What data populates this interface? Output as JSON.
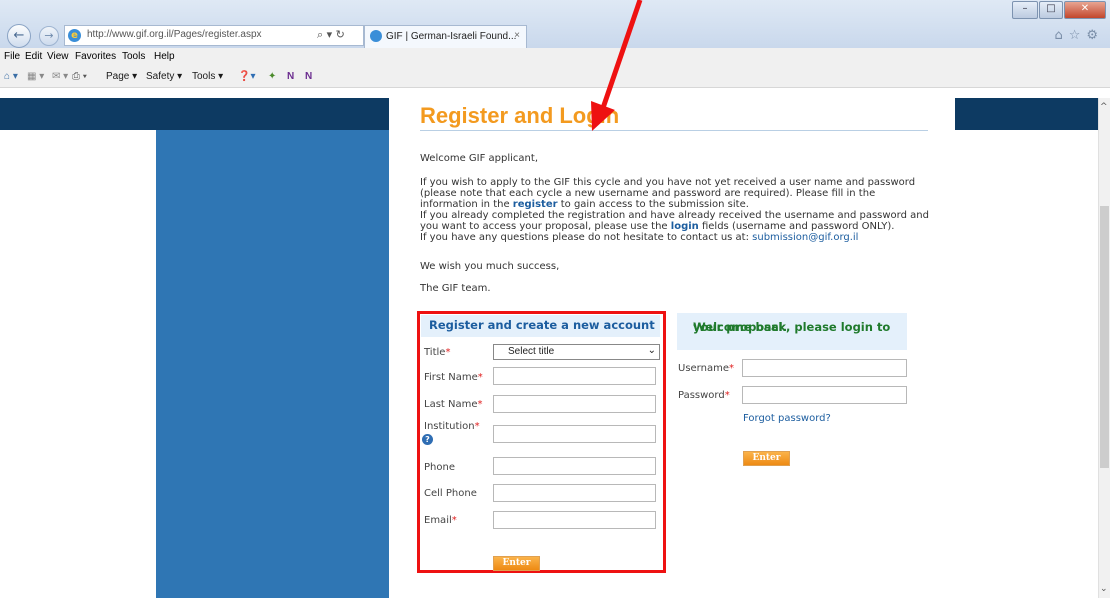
{
  "browser": {
    "address_url": "http://www.gif.org.il/Pages/register.aspx",
    "address_tools": "⌕ ▾ ↻",
    "tab_title": "GIF | German-Israeli Found...",
    "tab_close": "×",
    "menu": [
      "File",
      "Edit",
      "View",
      "Favorites",
      "Tools",
      "Help"
    ],
    "command_bar": [
      "Page ▾",
      "Safety ▾",
      "Tools ▾"
    ],
    "right_icons": "⌂☆⚙"
  },
  "page": {
    "title": "Register and Login",
    "intro": [
      "Welcome GIF applicant,",
      "",
      "If you wish to apply to the GIF this cycle and you have not yet received a user name and password",
      "(please note that each cycle a new username and password are required). Please fill in the",
      "information in the",
      "register",
      "to gain access to the submission site.",
      "If you already completed the registration and have already received the username and password and",
      "you want to access your proposal, please use the",
      "login",
      "fields (username and password ONLY).",
      "If you have any questions please do not hesitate to contact us at:",
      "submission@gif.org.il",
      "We wish you much success,",
      "The GIF team."
    ]
  },
  "register": {
    "heading": "Register and create a new account",
    "title_label": "Title",
    "title_select_value": "Select title",
    "first_name_label": "First Name",
    "last_name_label": "Last Name",
    "institution_label": "Institution",
    "phone_label": "Phone",
    "cell_phone_label": "Cell Phone",
    "email_label": "Email",
    "required_mark": "*",
    "enter_label": "Enter"
  },
  "login": {
    "heading_line1": "Welcome back, please login to",
    "heading_line2": "your proposal.",
    "username_label": "Username",
    "password_label": "Password",
    "required_mark": "*",
    "forgot_label": "Forgot password?",
    "enter_label": "Enter"
  },
  "colors": {
    "page_title": "#f39a1f",
    "register_heading": "#1c5d9f",
    "login_heading": "#1f7a2c",
    "highlight_border": "#ee1111",
    "blue_column": "#2f76b4",
    "navy_band": "#0d3a62"
  }
}
